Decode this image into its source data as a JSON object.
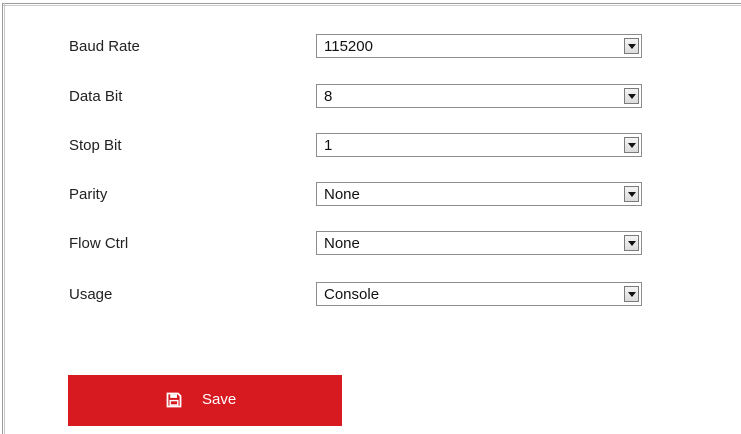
{
  "form": {
    "rows": [
      {
        "label": "Baud Rate",
        "value": "115200"
      },
      {
        "label": "Data Bit",
        "value": "8"
      },
      {
        "label": "Stop Bit",
        "value": "1"
      },
      {
        "label": "Parity",
        "value": "None"
      },
      {
        "label": "Flow Ctrl",
        "value": "None"
      },
      {
        "label": "Usage",
        "value": "Console"
      }
    ]
  },
  "actions": {
    "save_label": "Save",
    "save_icon": "floppy-disk-icon",
    "save_color": "#d71920"
  }
}
